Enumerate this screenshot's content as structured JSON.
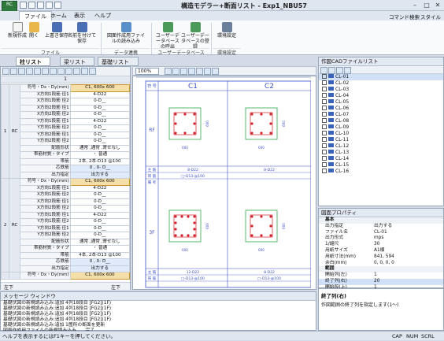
{
  "app": {
    "icon_text": "RC",
    "title": "構造モデラー+断面リスト - Exp1_NBU57",
    "cmd_search": "コマンド検索",
    "style_menu": "スタイル"
  },
  "ribbon": {
    "tabs": [
      "ファイル",
      "ホーム",
      "表示",
      "ヘルプ"
    ],
    "buttons": [
      {
        "label": "新規作成"
      },
      {
        "label": "開く"
      },
      {
        "label": "上書き保存"
      },
      {
        "label": "名前を付けて保存"
      },
      {
        "label": "図面作成用ファイルの読み込み"
      },
      {
        "label": "ユーザーデータベースの呼出"
      },
      {
        "label": "ユーザーデータベースの登録"
      },
      {
        "label": "環境設定"
      }
    ],
    "groups": [
      "ファイル",
      "データ連携",
      "ユーザーデータベース",
      "環境設定"
    ]
  },
  "doc_tabs": [
    "柱リスト",
    "梁リスト",
    "基礎リスト"
  ],
  "left_grid": {
    "col_header": "1",
    "footer_left": "左下",
    "footer_right": "左下",
    "groups": [
      {
        "floor": "1",
        "kind": "RC",
        "rows": [
          [
            "符号・Dx・Dy(mm)",
            "C1, 600x 600"
          ],
          [
            "X方向1段筋 径1",
            "4-D22"
          ],
          [
            "X方向1段筋 径2",
            "0-D__"
          ],
          [
            "X方向2段筋 径1",
            "0-D__"
          ],
          [
            "X方向2段筋 径2",
            "0-D__"
          ],
          [
            "Y方向1段筋 径1",
            "4-D22"
          ],
          [
            "Y方向1段筋 径2",
            "0-D__"
          ],
          [
            "Y方向2段筋 径1",
            "0-D__"
          ],
          [
            "Y方向2段筋 径2",
            "0-D__"
          ],
          [
            "配筋形状",
            "通常 ,通常 ,寄せなし"
          ],
          [
            "帯筋材質・タイプ",
            "・ 普通"
          ],
          [
            "帯筋",
            "2本, 2本-D13 @100"
          ],
          [
            "芯鉄筋",
            "0 , 0- D__"
          ],
          [
            "出力指定",
            "出力する"
          ]
        ]
      },
      {
        "floor": "2",
        "kind": "RC",
        "rows": [
          [
            "符号・Dx・Dy(mm)",
            "C1, 600x 600"
          ],
          [
            "X方向1段筋 径1",
            "4-D22"
          ],
          [
            "X方向1段筋 径2",
            "0-D__"
          ],
          [
            "X方向2段筋 径1",
            "0-D__"
          ],
          [
            "X方向2段筋 径2",
            "0-D__"
          ],
          [
            "Y方向1段筋 径1",
            "4-D22"
          ],
          [
            "Y方向1段筋 径2",
            "0-D__"
          ],
          [
            "Y方向2段筋 径1",
            "0-D__"
          ],
          [
            "Y方向2段筋 径2",
            "0-D__"
          ],
          [
            "配筋形状",
            "通常 ,通常 ,寄せなし"
          ],
          [
            "帯筋材質・タイプ",
            "・ 普通"
          ],
          [
            "帯筋",
            "4本, 2本-D13 @100"
          ],
          [
            "芯鉄筋",
            "0 , 0- D__"
          ],
          [
            "出力指定",
            "出力する"
          ]
        ]
      },
      {
        "floor": "",
        "kind": "",
        "rows": [
          [
            "符号・Dx・Dy(mm)",
            "C1, 600x 600"
          ]
        ]
      }
    ]
  },
  "drawing": {
    "zoom": "100%",
    "header_label": "符 号",
    "columns": [
      "C1",
      "C2"
    ],
    "floors": [
      {
        "name": "RF",
        "size_label": "600",
        "side_label": "600",
        "main_label": "主 筋",
        "main": [
          "8-D22",
          "",
          "8-D22"
        ],
        "hoop_label": "帯 筋",
        "hoop": [
          "□-D13-@100",
          ""
        ],
        "note_label": "備 考"
      },
      {
        "name": "3F",
        "size_label": "600",
        "side_label": "600",
        "main_label": "主 筋",
        "main": [
          "12-D22",
          "",
          "8-D22"
        ],
        "hoop_label": "帯 筋",
        "hoop": [
          "□-D13-@100",
          "□-D13-@100"
        ],
        "note_label": ""
      }
    ]
  },
  "cad_list": {
    "title": "作図CADファイルリスト",
    "items": [
      "CL-01",
      "CL-02",
      "CL-03",
      "CL-04",
      "CL-05",
      "CL-06",
      "CL-07",
      "CL-08",
      "CL-09",
      "CL-10",
      "CL-11",
      "CL-12",
      "CL-13",
      "CL-14",
      "CL-15",
      "CL-16"
    ]
  },
  "props": {
    "title": "図面プロパティ",
    "rows": [
      {
        "cat": true,
        "k": "基本",
        "v": ""
      },
      {
        "k": "出力指定",
        "v": "出力する"
      },
      {
        "k": "ファイル名",
        "v": "CL-01"
      },
      {
        "k": "出力形式",
        "v": "mps"
      },
      {
        "k": "1/縮尺",
        "v": "30"
      },
      {
        "k": "用紙サイズ",
        "v": "A1横"
      },
      {
        "k": "用紙寸法(mm)",
        "v": "841, 594"
      },
      {
        "k": "余白(mm)",
        "v": "0, 0, 0, 0"
      },
      {
        "cat": true,
        "k": "範囲",
        "v": ""
      },
      {
        "k": "開始列(左)",
        "v": "1"
      },
      {
        "k": "終了列(右)",
        "v": "20"
      },
      {
        "k": "開始段(上)",
        "v": "1"
      },
      {
        "k": "終了段(下)",
        "v": "7"
      },
      {
        "cat": true,
        "k": "拡張",
        "v": ""
      },
      {
        "k": "構造図",
        "v": "使用しない"
      },
      {
        "k": "縮尺図",
        "v": "使用しない"
      },
      {
        "k": "図面枠CADファイル",
        "v": "使用しない"
      },
      {
        "k": "図面枠CADファイル名",
        "v": ""
      }
    ],
    "help_title": "終了列(右)",
    "help_text": "作図範囲の終了列を指定します(1〜)"
  },
  "messages": {
    "title": "メッセージ ウィンドウ",
    "lines": [
      "基礎伏図の新規読み込み:追加 4列18段目 [FG2](1F)",
      "基礎伏図の新規読み込み:追加 4列18段目 [FG2](1F)",
      "基礎伏図の新規読み込み:追加 4列18段目 [FG2](1F)",
      "基礎伏図の新規読み込み:追加 4列18段目 [FG2](1F)",
      "基礎伏図の新規読み込み:追加 1箇所の断面を更新",
      "図面作成用ファイルの新規読み込み……完了"
    ]
  },
  "status": {
    "text": "ヘルプを表示するにはF1キーを押してください。",
    "ind": [
      "CAP",
      "NUM",
      "SCRL"
    ]
  }
}
